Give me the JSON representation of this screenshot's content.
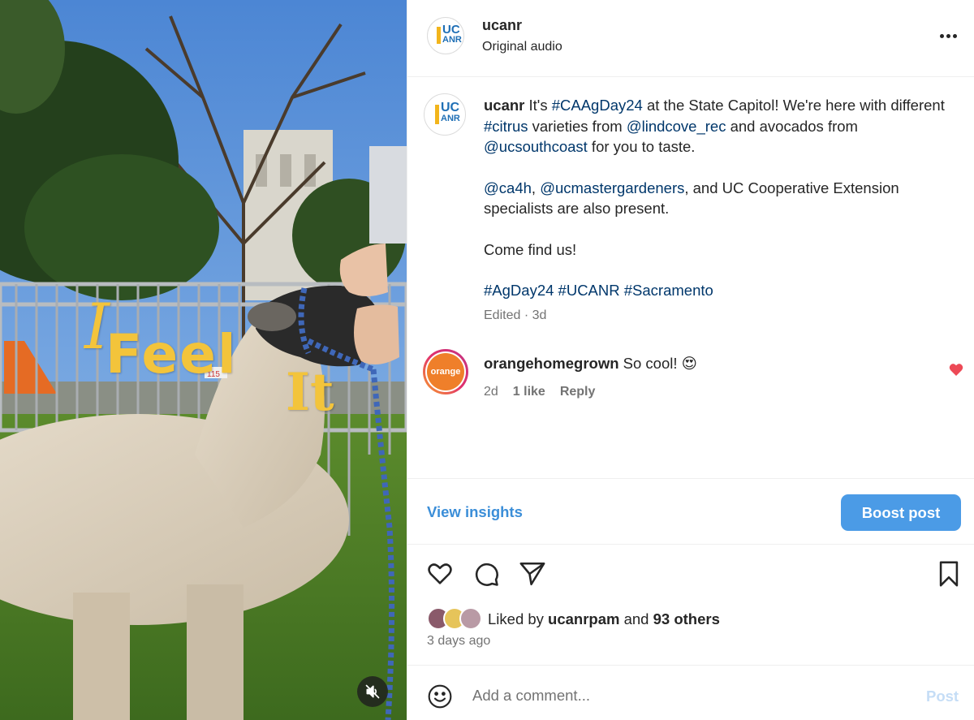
{
  "media": {
    "overlay_line1": "I",
    "overlay_line2": "Feel",
    "overlay_line3": "It",
    "tag_number": "115",
    "mute_icon": "speaker-muted-icon"
  },
  "header": {
    "username": "ucanr",
    "audio": "Original audio",
    "logo_top": "UC",
    "logo_bottom": "ANR",
    "more_icon": "ellipsis-icon"
  },
  "caption": {
    "username": "ucanr",
    "p1_a": " It's ",
    "p1_tag1": "#CAAgDay24",
    "p1_b": " at the State Capitol! We're here with different ",
    "p1_tag2": "#citrus",
    "p1_c": " varieties from ",
    "p1_mention1": "@lindcove_rec",
    "p1_d": " and avocados from ",
    "p1_mention2": "@ucsouthcoast",
    "p1_e": " for you to taste.",
    "p2_mention1": "@ca4h",
    "p2_a": ", ",
    "p2_mention2": "@ucmastergardeners",
    "p2_b": ", and UC Cooperative Extension specialists are also present.",
    "p3": "Come find us!",
    "p4_tag1": "#AgDay24",
    "p4_tag2": "#UCANR",
    "p4_tag3": "#Sacramento",
    "time": "Edited · 3d"
  },
  "comment": {
    "avatar_label": "orange",
    "username": "orangehomegrown",
    "text": " So cool! 😍",
    "time": "2d",
    "likes": "1 like",
    "reply": "Reply"
  },
  "insights": {
    "view_label": "View insights",
    "boost_label": "Boost post"
  },
  "actions": {
    "liked_prefix": "Liked by ",
    "liked_user": "ucanrpam",
    "liked_mid": " and ",
    "liked_others": "93 others",
    "days_ago": "3 days ago"
  },
  "add_comment": {
    "placeholder": "Add a comment...",
    "post_label": "Post"
  },
  "colors": {
    "link": "#00376b",
    "accent_blue": "#4b9be6",
    "like_red": "#ed4956",
    "overlay_yellow": "#f3c43b"
  }
}
